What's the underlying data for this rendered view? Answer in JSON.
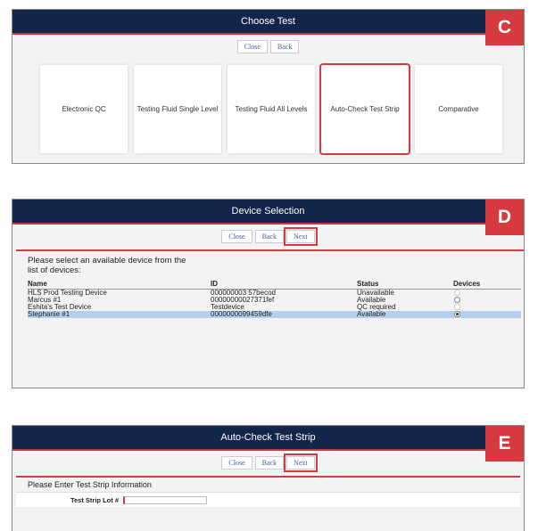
{
  "panel_c": {
    "title": "Choose Test",
    "badge": "C",
    "buttons": {
      "close": "Close",
      "back": "Back"
    },
    "cards": [
      "Electronic QC",
      "Testing Fluid Single Level",
      "Testing Fluid All Levels",
      "Auto-Check Test Strip",
      "Comparative"
    ]
  },
  "panel_d": {
    "title": "Device Selection",
    "badge": "D",
    "buttons": {
      "close": "Close",
      "back": "Back",
      "next": "Next"
    },
    "prompt": "Please select an available device from the list of devices:",
    "columns": [
      "Name",
      "ID",
      "Status",
      "Devices"
    ],
    "rows": [
      {
        "name": "HLS Prod Testing Device",
        "id": "000000003 57becod",
        "status": "Unavailable"
      },
      {
        "name": "Marcus #1",
        "id": "00000000027371fef",
        "status": "Available"
      },
      {
        "name": "Eshita's Test Device",
        "id": "Testdevice",
        "status": "QC required"
      },
      {
        "name": "Stephanie #1",
        "id": "0000000099459dfe",
        "status": "Available"
      }
    ]
  },
  "panel_e": {
    "title": "Auto-Check Test Strip",
    "badge": "E",
    "buttons": {
      "close": "Close",
      "back": "Back",
      "next": "Next"
    },
    "section_title": "Please Enter Test Strip Information",
    "field_label": "Test Strip Lot #"
  }
}
